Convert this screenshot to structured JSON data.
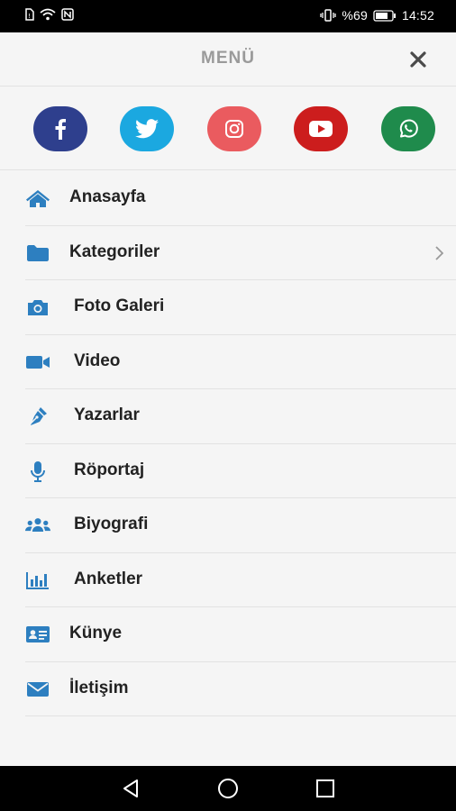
{
  "status": {
    "battery_percent": "%69",
    "time": "14:52"
  },
  "header": {
    "title": "MENÜ"
  },
  "social": [
    {
      "name": "facebook",
      "color": "#2e3f8d"
    },
    {
      "name": "twitter",
      "color": "#1ba8e0"
    },
    {
      "name": "instagram",
      "color": "#ea5b5f"
    },
    {
      "name": "youtube",
      "color": "#cc1d1d"
    },
    {
      "name": "whatsapp",
      "color": "#1f8b4c"
    }
  ],
  "menu": {
    "accent_color": "#2d7fc0",
    "items": [
      {
        "label": "Anasayfa",
        "icon": "home-icon"
      },
      {
        "label": "Kategoriler",
        "icon": "folder-icon",
        "has_submenu": true
      },
      {
        "label": "Foto Galeri",
        "icon": "camera-icon"
      },
      {
        "label": "Video",
        "icon": "video-camera-icon"
      },
      {
        "label": "Yazarlar",
        "icon": "pen-icon"
      },
      {
        "label": "Röportaj",
        "icon": "microphone-icon"
      },
      {
        "label": "Biyografi",
        "icon": "users-icon"
      },
      {
        "label": "Anketler",
        "icon": "bar-chart-icon"
      },
      {
        "label": "Künye",
        "icon": "id-card-icon"
      },
      {
        "label": "İletişim",
        "icon": "envelope-icon"
      }
    ]
  }
}
